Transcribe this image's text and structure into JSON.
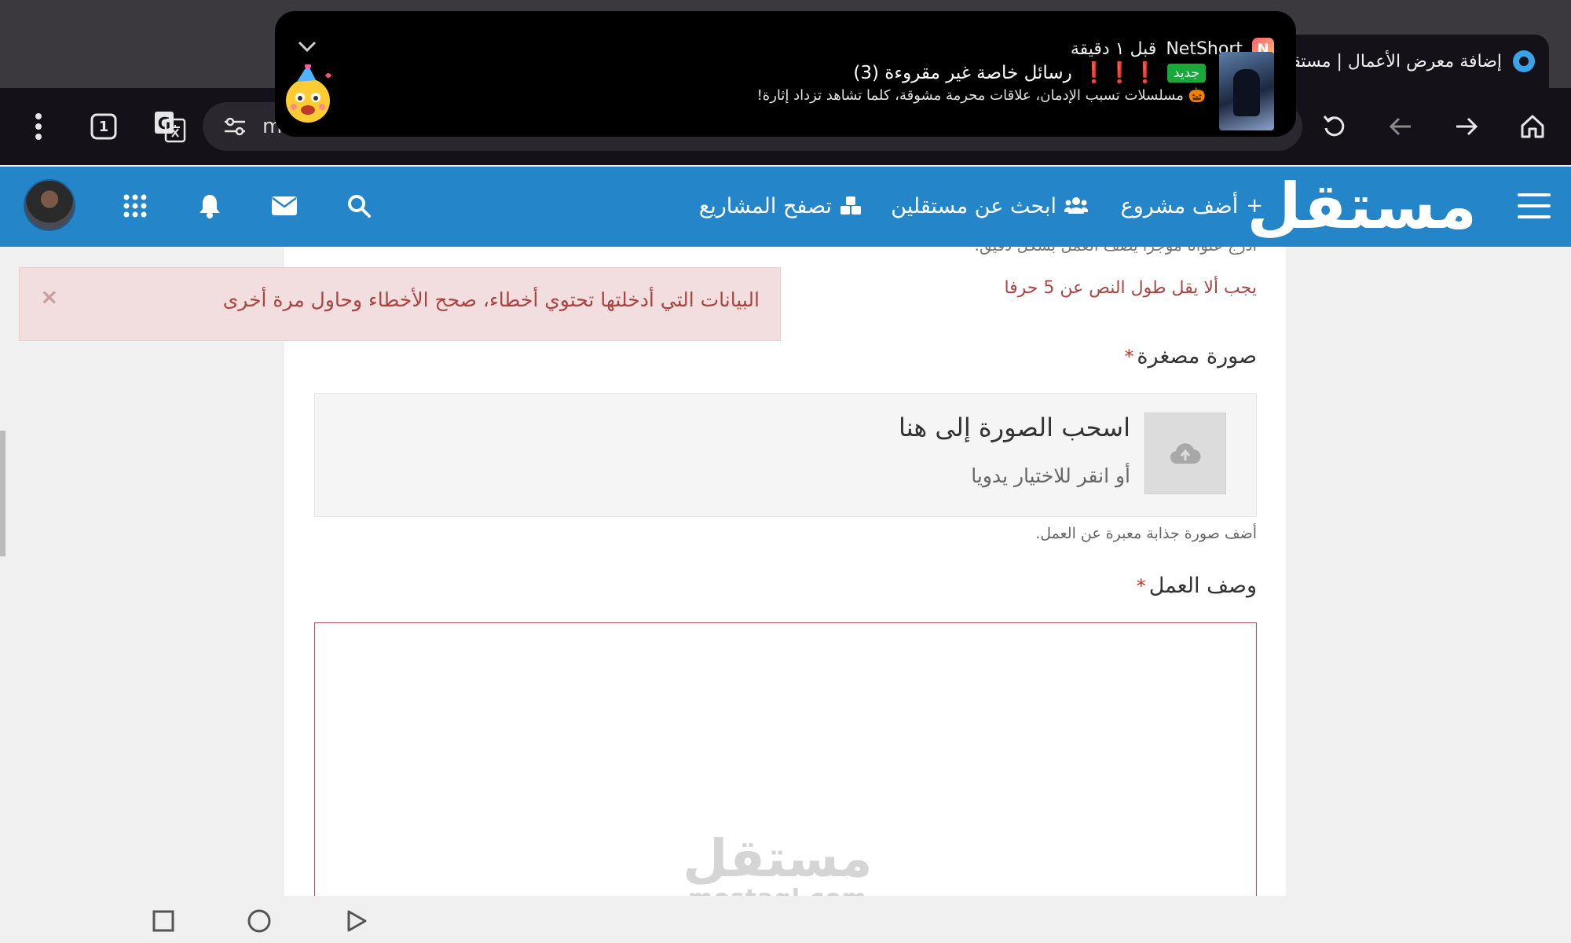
{
  "browser": {
    "tab_title": "إضافة معرض الأعمال | مستقل",
    "url_text": "m",
    "tab_count": "1"
  },
  "notification": {
    "app_name": "NetShort",
    "app_initial": "N",
    "time": "قبل ١ دقيقة",
    "badge": "جديد",
    "title_prefix": "❗❗❗",
    "title": "رسائل خاصة غير مقروءة (3)",
    "body": "🎃 مسلسلات تسبب الإدمان، علاقات محرمة مشوقة، كلما تشاهد تزداد إثارة!"
  },
  "header": {
    "logo": "مستقل",
    "nav": [
      {
        "label": "أضف مشروع",
        "icon": "+"
      },
      {
        "label": "ابحث عن مستقلين",
        "icon": "👥"
      },
      {
        "label": "تصفح المشاريع",
        "icon": "⚙"
      }
    ]
  },
  "form": {
    "title_hint": "أدرج عنوانا موجزا يصف العمل بشكل دقيق.",
    "title_error": "يجب ألا يقل طول النص عن 5 حرفا",
    "alert": "البيانات التي أدخلتها تحتوي أخطاء، صحح الأخطاء وحاول مرة أخرى",
    "alert_close": "×",
    "thumbnail_label": "صورة مصغرة",
    "required_mark": "*",
    "drop_title": "اسحب الصورة إلى هنا",
    "drop_sub": "أو انقر للاختيار يدويا",
    "thumbnail_help": "أضف صورة جذابة معبرة عن العمل.",
    "description_label": "وصف العمل"
  },
  "watermark": {
    "logo": "مستقل",
    "url": "mostaql.com"
  },
  "colors": {
    "brand_blue": "#2485c9",
    "error_red": "#a94442",
    "alert_bg": "#f2dede"
  }
}
